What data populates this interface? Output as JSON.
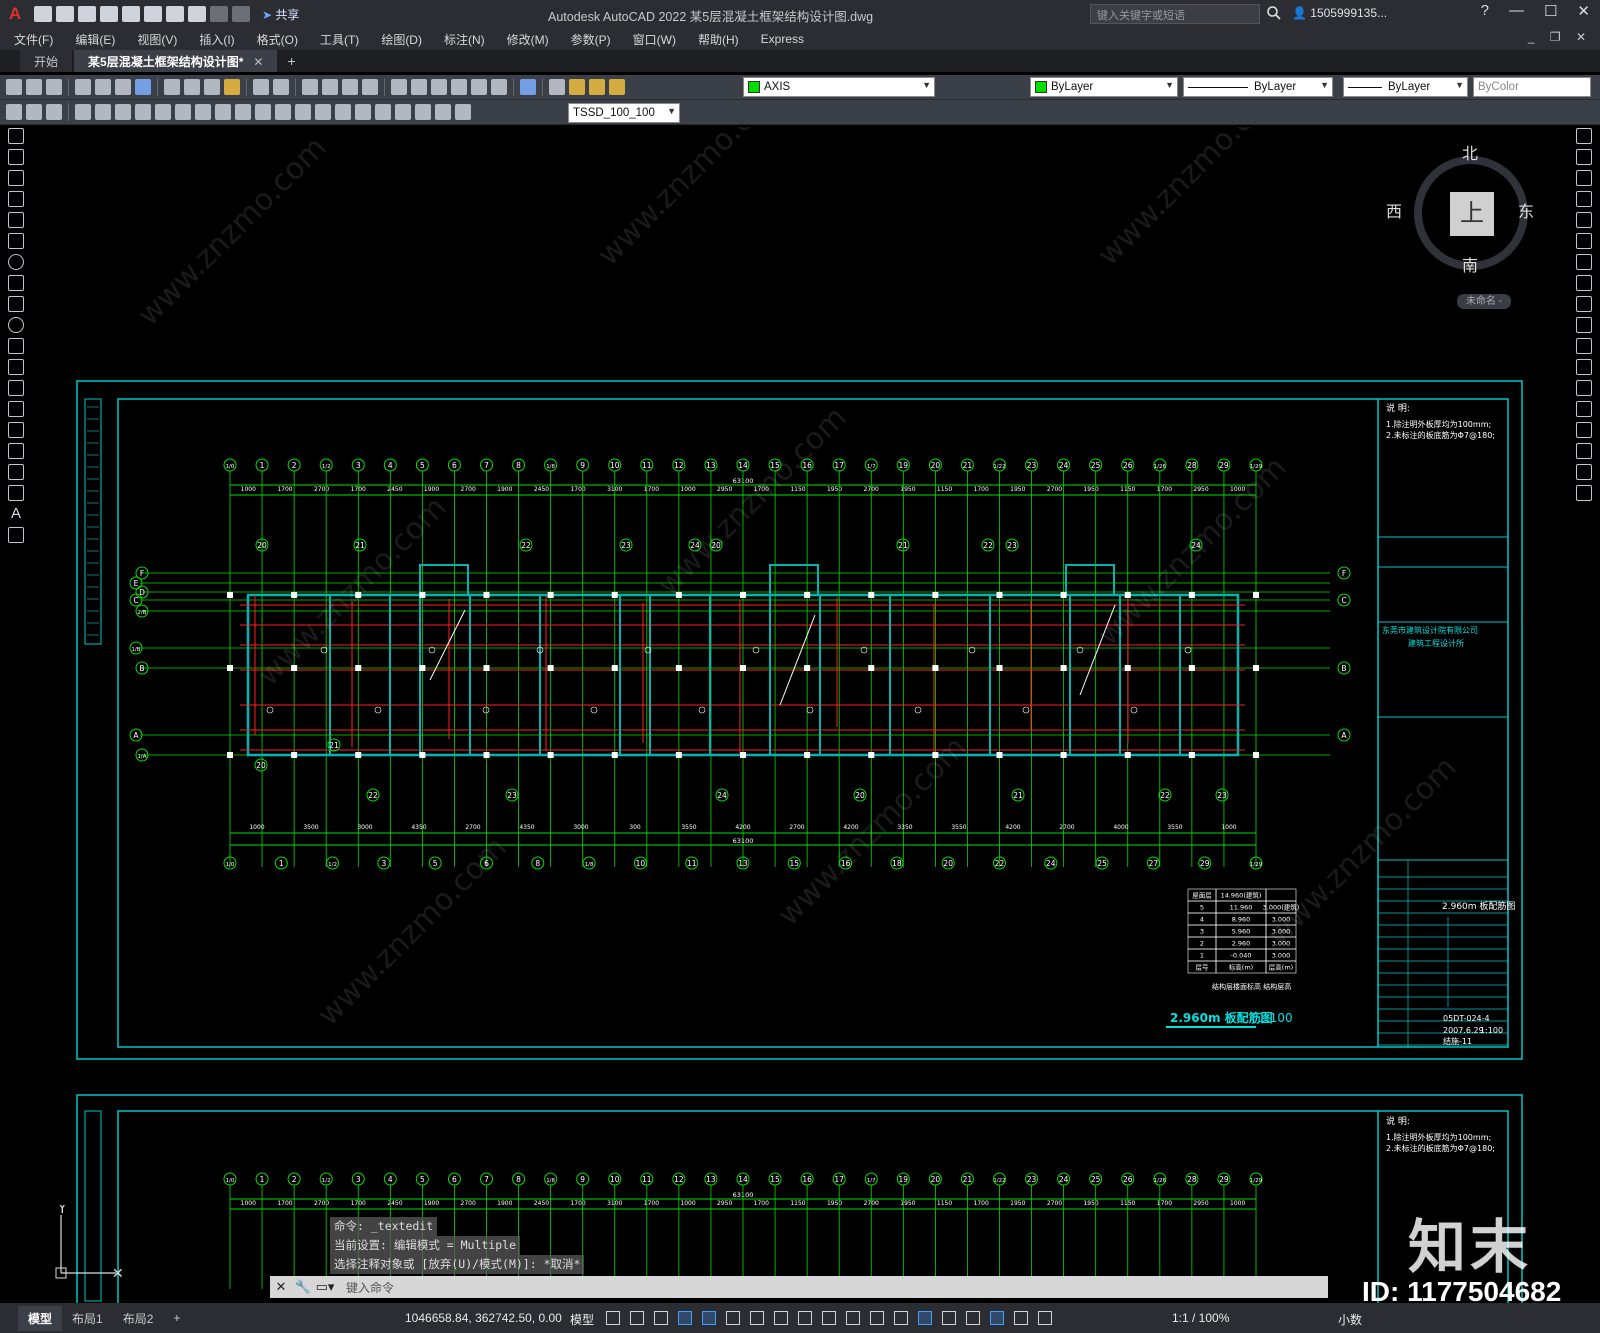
{
  "app": {
    "logo": "A",
    "title": "Autodesk AutoCAD 2022    某5层混凝土框架结构设计图.dwg",
    "share": "共享",
    "search_placeholder": "键入关键字或短语",
    "user": "1505999135...",
    "window_buttons": [
      "?",
      "—",
      "☐",
      "✕"
    ]
  },
  "menu": [
    "文件(F)",
    "编辑(E)",
    "视图(V)",
    "插入(I)",
    "格式(O)",
    "工具(T)",
    "绘图(D)",
    "标注(N)",
    "修改(M)",
    "参数(P)",
    "窗口(W)",
    "帮助(H)",
    "Express"
  ],
  "tabs": {
    "start": "开始",
    "active": "某5层混凝土框架结构设计图*",
    "add": "+"
  },
  "toolbar": {
    "layer": "AXIS",
    "color": "ByLayer",
    "linetype": "ByLayer",
    "lineweight": "ByLayer",
    "plotstyle": "ByColor",
    "dimstyle": "TSSD_100_100"
  },
  "viewcube": {
    "north": "北",
    "south": "南",
    "west": "西",
    "east": "东",
    "face": "上",
    "wcs": "未命名 -"
  },
  "drawing": {
    "colors": {
      "frame": "#00c8c8",
      "axis": "#00e000",
      "beam": "#ff2020",
      "wall": "#00b4b4",
      "dim": "#ffffff"
    },
    "axis_labels_top": [
      "1/0",
      "1",
      "2",
      "1/2",
      "3",
      "4",
      "5",
      "6",
      "7",
      "8",
      "1/8",
      "9",
      "10",
      "11",
      "12",
      "13",
      "14",
      "15",
      "16",
      "17",
      "1/7",
      "19",
      "20",
      "21",
      "1/22",
      "23",
      "24",
      "25",
      "26",
      "1/26",
      "28",
      "29",
      "1/29"
    ],
    "axis_labels_bottom": [
      "1/0",
      "1",
      "1/2",
      "3",
      "5",
      "6",
      "8",
      "1/8",
      "10",
      "11",
      "13",
      "15",
      "16",
      "18",
      "20",
      "22",
      "24",
      "25",
      "27",
      "29",
      "1/29"
    ],
    "row_labels": [
      "F",
      "E",
      "D",
      "C",
      "2/B",
      "1/B",
      "B",
      "A",
      "1/A"
    ],
    "total_dim": "63100",
    "top_dims": [
      "1000",
      "1700",
      "2700",
      "1700",
      "2450",
      "1900",
      "2700",
      "1900",
      "2450",
      "1700",
      "3100",
      "1700",
      "1000",
      "2950",
      "1700",
      "1150",
      "1950",
      "2700",
      "1950",
      "1150",
      "1700",
      "1950",
      "2700",
      "1950",
      "1150",
      "1700",
      "2950",
      "1000"
    ],
    "bottom_dims": [
      "1000",
      "3500",
      "3000",
      "4350",
      "2700",
      "4350",
      "3000",
      "300",
      "3550",
      "4200",
      "2700",
      "4200",
      "3350",
      "3550",
      "4200",
      "2700",
      "4000",
      "3550",
      "1000"
    ],
    "notes_title": "说 明:",
    "notes": [
      "1.除注明外板厚均为100mm;",
      "2.未标注的板底筋为Φ7@180;"
    ],
    "title_block": {
      "company": "东莞市建筑设计院有限公司",
      "dept": "建筑工程设计所",
      "drawing_name": "2.960m 板配筋图",
      "drawing_no": "05DT-024-4",
      "date": "2007.6.29",
      "scale": "1:100",
      "sheet": "结施-11"
    },
    "level_table": {
      "rows": [
        [
          "屋面层",
          "14.960(建筑)",
          ""
        ],
        [
          "5",
          "11.960",
          "3.000(建筑)"
        ],
        [
          "4",
          "8.960",
          "3.000"
        ],
        [
          "3",
          "5.960",
          "3.000"
        ],
        [
          "2",
          "2.960",
          "3.000"
        ],
        [
          "1",
          "-0.040",
          "3.000"
        ],
        [
          "层号",
          "标高(m)",
          "层高(m)"
        ]
      ],
      "caption": "结构层楼面标高 结构层高"
    },
    "plan_title": "2.960m 板配筋图",
    "plan_scale": "1:100"
  },
  "command": {
    "history": [
      "命令: _textedit",
      "当前设置: 编辑模式 = Multiple",
      "选择注释对象或 [放弃(U)/模式(M)]: *取消*"
    ],
    "prompt": "键入命令"
  },
  "statusbar": {
    "layouts": [
      "模型",
      "布局1",
      "布局2",
      "+"
    ],
    "coords": "1046658.84, 362742.50, 0.00",
    "space": "模型",
    "scale": "1:1 / 100%",
    "units": "小数"
  },
  "watermark": {
    "logo": "知末",
    "id": "ID: 1177504682",
    "site": "www.znzmo.com"
  }
}
